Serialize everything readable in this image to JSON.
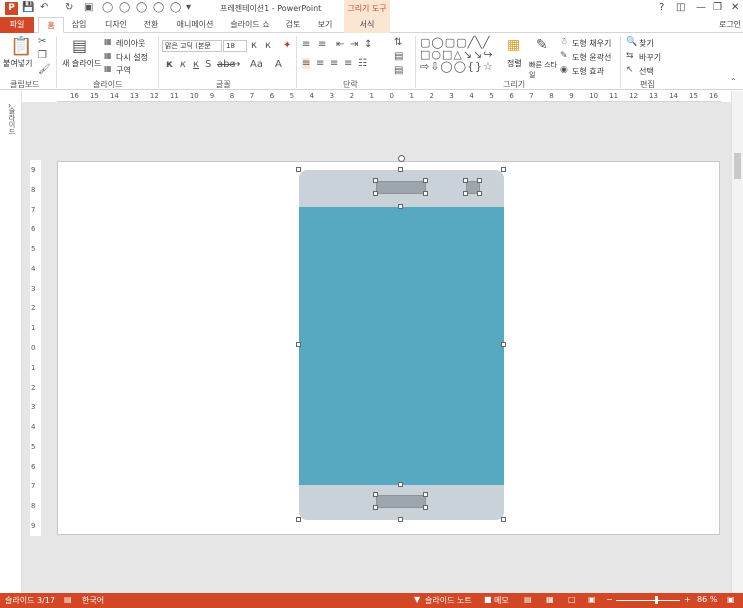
{
  "window": {
    "title": "프레젠테이션1 - PowerPoint",
    "context_tab_group": "그리기 도구",
    "help": "?",
    "login": "로그인"
  },
  "tabs": [
    {
      "label": "파일"
    },
    {
      "label": "홈"
    },
    {
      "label": "삽입"
    },
    {
      "label": "디자인"
    },
    {
      "label": "전환"
    },
    {
      "label": "애니메이션"
    },
    {
      "label": "슬라이드 쇼"
    },
    {
      "label": "검토"
    },
    {
      "label": "보기"
    },
    {
      "label": "서식"
    }
  ],
  "ribbon": {
    "clipboard": {
      "paste": "붙여넣기",
      "label": "클립보드"
    },
    "slides": {
      "new_slide": "새 슬라이드",
      "layout": "레이아웃",
      "reset": "다시 설정",
      "section": "구역",
      "label": "슬라이드"
    },
    "font": {
      "font_name": "맑은 고딕 (본문",
      "font_size": "18",
      "label": "글꼴"
    },
    "paragraph": {
      "label": "단락"
    },
    "drawing": {
      "arrange": "정렬",
      "quick_styles": "빠른 스타일",
      "shape_fill": "도형 채우기",
      "shape_outline": "도형 윤곽선",
      "shape_effects": "도형 효과",
      "label": "그리기"
    },
    "editing": {
      "find": "찾기",
      "replace": "바꾸기",
      "select": "선택",
      "label": "편집"
    }
  },
  "ruler": {
    "horizontal": [
      "16",
      "15",
      "14",
      "13",
      "12",
      "11",
      "10",
      "9",
      "8",
      "7",
      "6",
      "5",
      "4",
      "3",
      "2",
      "1",
      "0",
      "1",
      "2",
      "3",
      "4",
      "5",
      "6",
      "7",
      "8",
      "9",
      "10",
      "11",
      "12",
      "13",
      "14",
      "15",
      "16"
    ],
    "vertical": [
      "9",
      "8",
      "7",
      "6",
      "5",
      "4",
      "3",
      "2",
      "1",
      "0",
      "1",
      "2",
      "3",
      "4",
      "5",
      "6",
      "7",
      "8",
      "9"
    ]
  },
  "left_panel": {
    "label": "슬라이드"
  },
  "status": {
    "slide_info": "슬라이드 3/17",
    "language": "한국어",
    "notes": "슬라이드 노트",
    "comments": "메모",
    "zoom": "86 %"
  },
  "colors": {
    "accent": "#d24726",
    "phone_frame": "#c9d2d9",
    "phone_screen": "#56a9c0",
    "phone_button": "#9ea6ad"
  }
}
